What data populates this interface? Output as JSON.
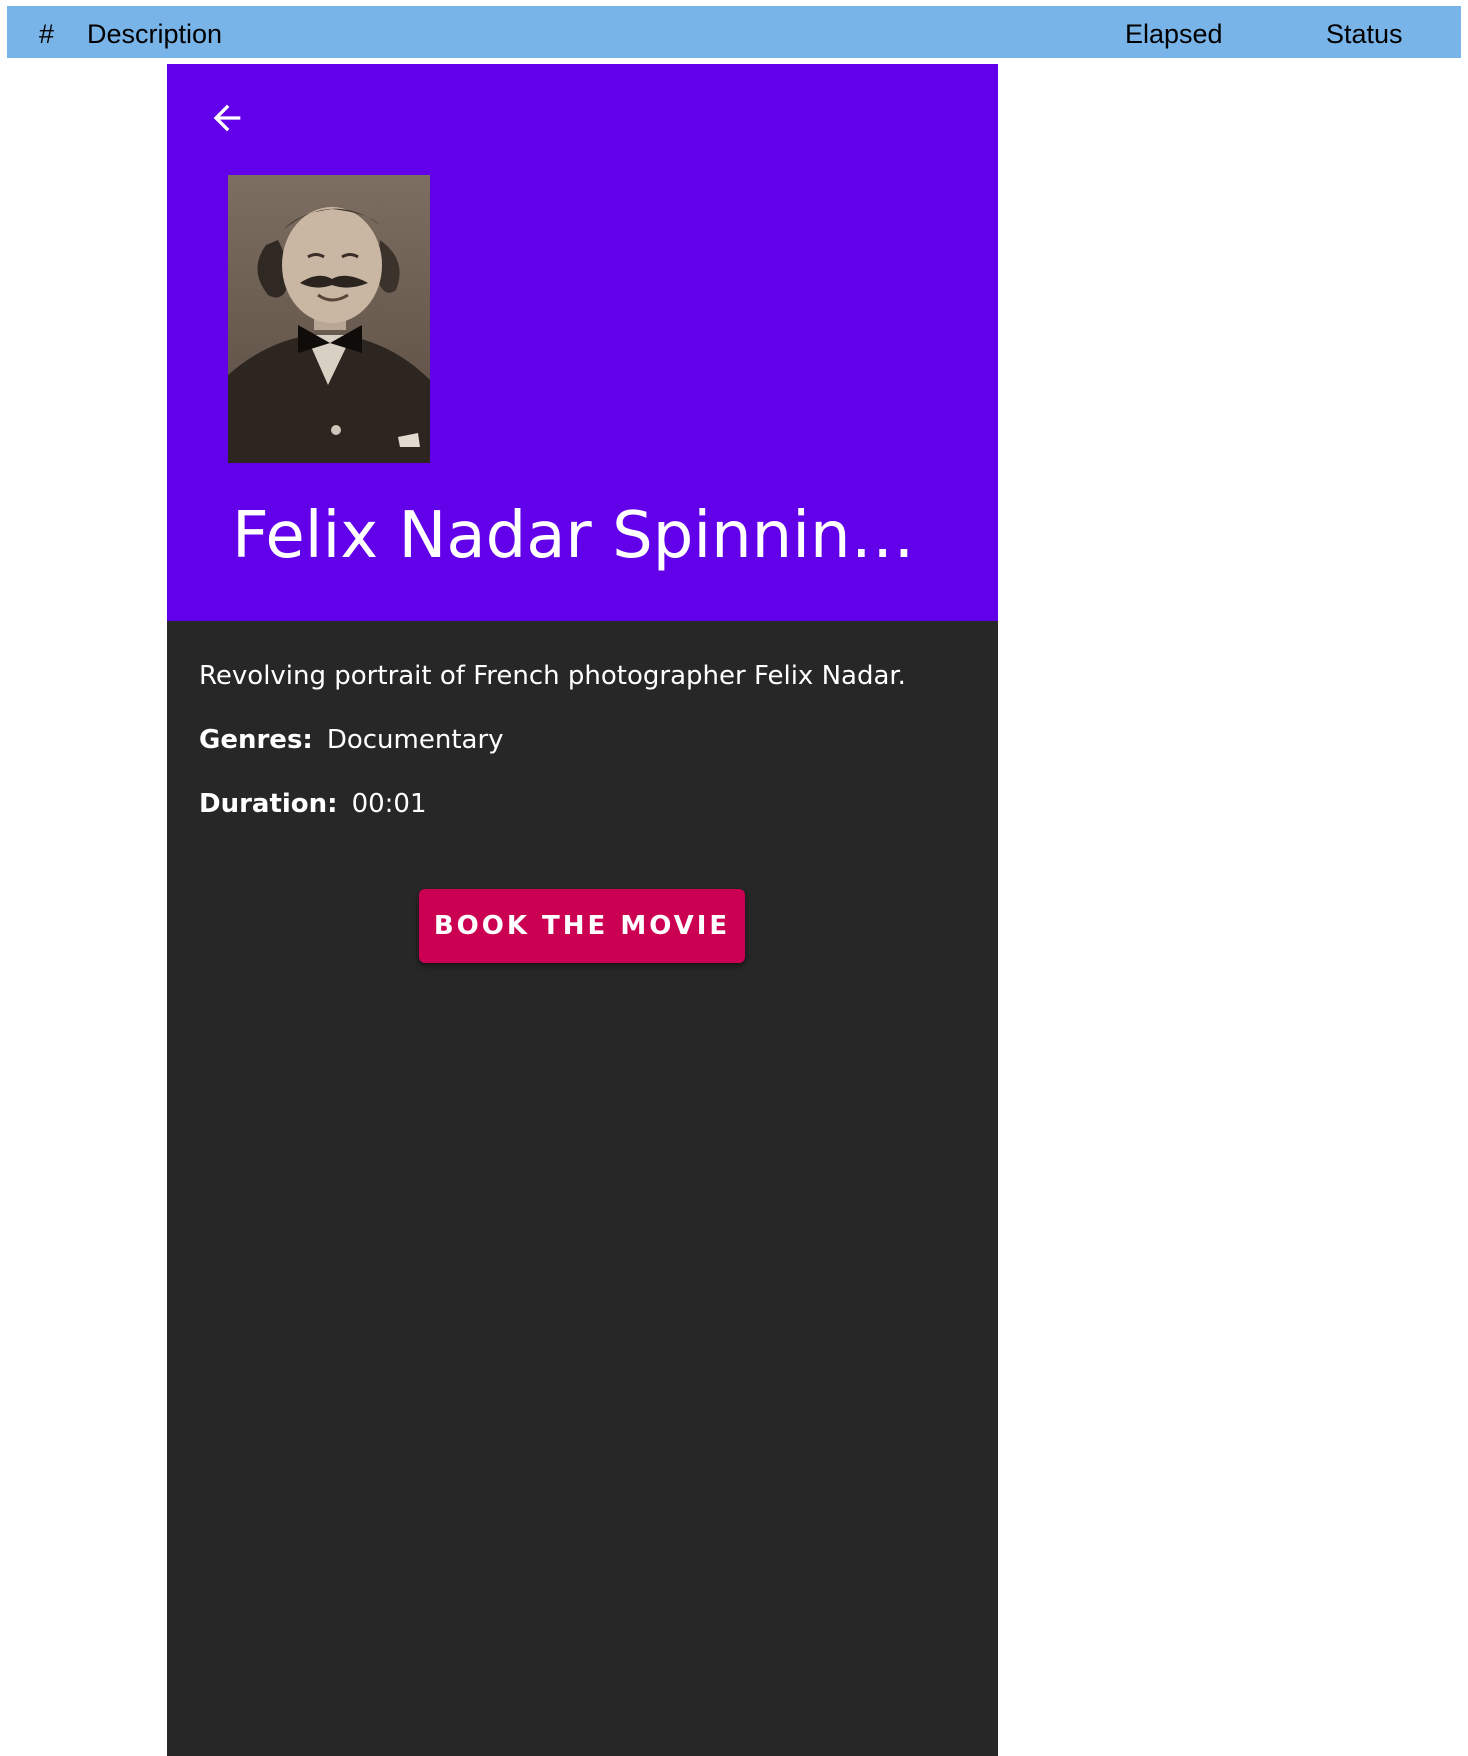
{
  "table_header": {
    "num": "#",
    "description": "Description",
    "elapsed": "Elapsed",
    "status": "Status"
  },
  "movie": {
    "title": "Felix Nadar Spinning…",
    "description": "Revolving portrait of French photographer Felix Nadar.",
    "genres_label": "Genres:",
    "genres": "Documentary",
    "duration_label": "Duration:",
    "duration": "00:01"
  },
  "actions": {
    "book_label": "BOOK THE MOVIE"
  },
  "icons": {
    "back": "arrow-back-icon"
  },
  "colors": {
    "header_bar": "#79b4e8",
    "app_bar": "#6200ea",
    "background": "#272727",
    "button": "#cc0052"
  }
}
